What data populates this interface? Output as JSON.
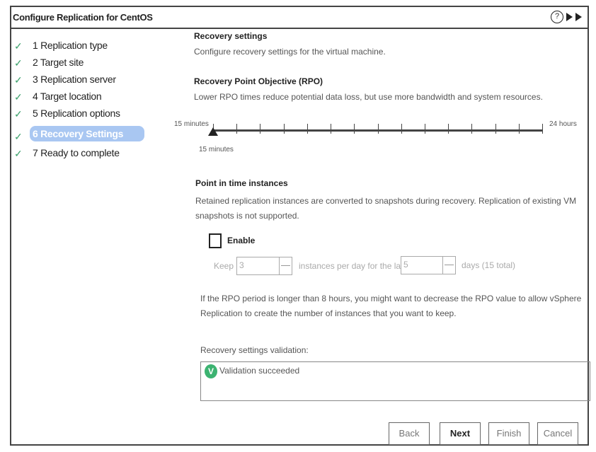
{
  "window": {
    "title": "Configure Replication for CentOS",
    "help_icon": "?"
  },
  "steps": [
    {
      "label": "1 Replication type",
      "done": true
    },
    {
      "label": "2 Target site",
      "done": true
    },
    {
      "label": "3 Replication server",
      "done": true
    },
    {
      "label": "4 Target location",
      "done": true
    },
    {
      "label": "5 Replication options",
      "done": true
    },
    {
      "label": "6 Recovery Settings",
      "active": true
    },
    {
      "label": "7 Ready to complete",
      "done": true
    }
  ],
  "recovery": {
    "heading": "Recovery settings",
    "desc": "Configure recovery settings for the virtual machine."
  },
  "rpo": {
    "heading": "Recovery Point Objective (RPO)",
    "desc": "Lower RPO times reduce potential data loss, but use more bandwidth and system resources.",
    "min_label": "15 minutes",
    "max_label": "24 hours",
    "value_label": "15 minutes",
    "value_fraction": 0
  },
  "pit": {
    "heading": "Point in time instances",
    "desc": "Retained replication instances are converted to snapshots during recovery. Replication of existing VM snapshots is not supported.",
    "enable_label": "Enable",
    "enabled": false,
    "keep_label": "Keep",
    "keep_value": "3",
    "per_day_label": "instances per day for the last",
    "days_value": "5",
    "days_label": "days (15 total)",
    "note": "If the RPO period is longer than 8 hours, you might want to decrease the RPO value to allow vSphere Replication to create the number of instances that you want to keep."
  },
  "validation": {
    "label": "Recovery settings validation:",
    "message": "Validation succeeded",
    "status_color": "#3cb371"
  },
  "buttons": {
    "back": "Back",
    "next": "Next",
    "finish": "Finish",
    "cancel": "Cancel"
  },
  "colors": {
    "active_step": "#a9c7f2",
    "check": "#3aa06a"
  }
}
